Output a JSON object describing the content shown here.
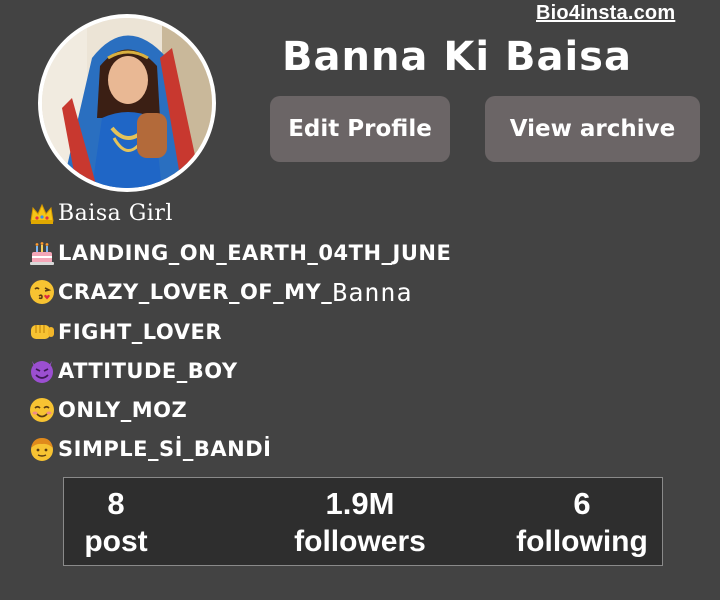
{
  "watermark": "Bio4insta.com",
  "profile": {
    "username": "Banna Ki Baisa",
    "avatar_icon": "profile-photo"
  },
  "buttons": {
    "edit_profile": "Edit Profile",
    "view_archive": "View archive"
  },
  "bio": [
    {
      "icon": "crown-icon",
      "text": "Baisa Girl"
    },
    {
      "icon": "birthday-cake-icon",
      "text": "LANDING_ON_EARTH_04TH_JUNE"
    },
    {
      "icon": "kissing-face-icon",
      "text": "CRAZY_LOVER_OF_MY_",
      "text_extra": "Banna"
    },
    {
      "icon": "fist-icon",
      "text": "FIGHT_LOVER"
    },
    {
      "icon": "smiling-devil-icon",
      "text": "ATTITUDE_BOY"
    },
    {
      "icon": "smiling-face-icon",
      "text": "ONLY_MOZ"
    },
    {
      "icon": "boy-face-icon",
      "text": "SIMPLE_Sİ_BANDİ"
    }
  ],
  "stats": [
    {
      "value": "8",
      "label": "post"
    },
    {
      "value": "1.9M",
      "label": "followers"
    },
    {
      "value": "6",
      "label": "following"
    }
  ],
  "colors": {
    "background": "#434343",
    "button": "#6b6566",
    "stats_box": "#2e2e2e",
    "text": "#ffffff"
  }
}
